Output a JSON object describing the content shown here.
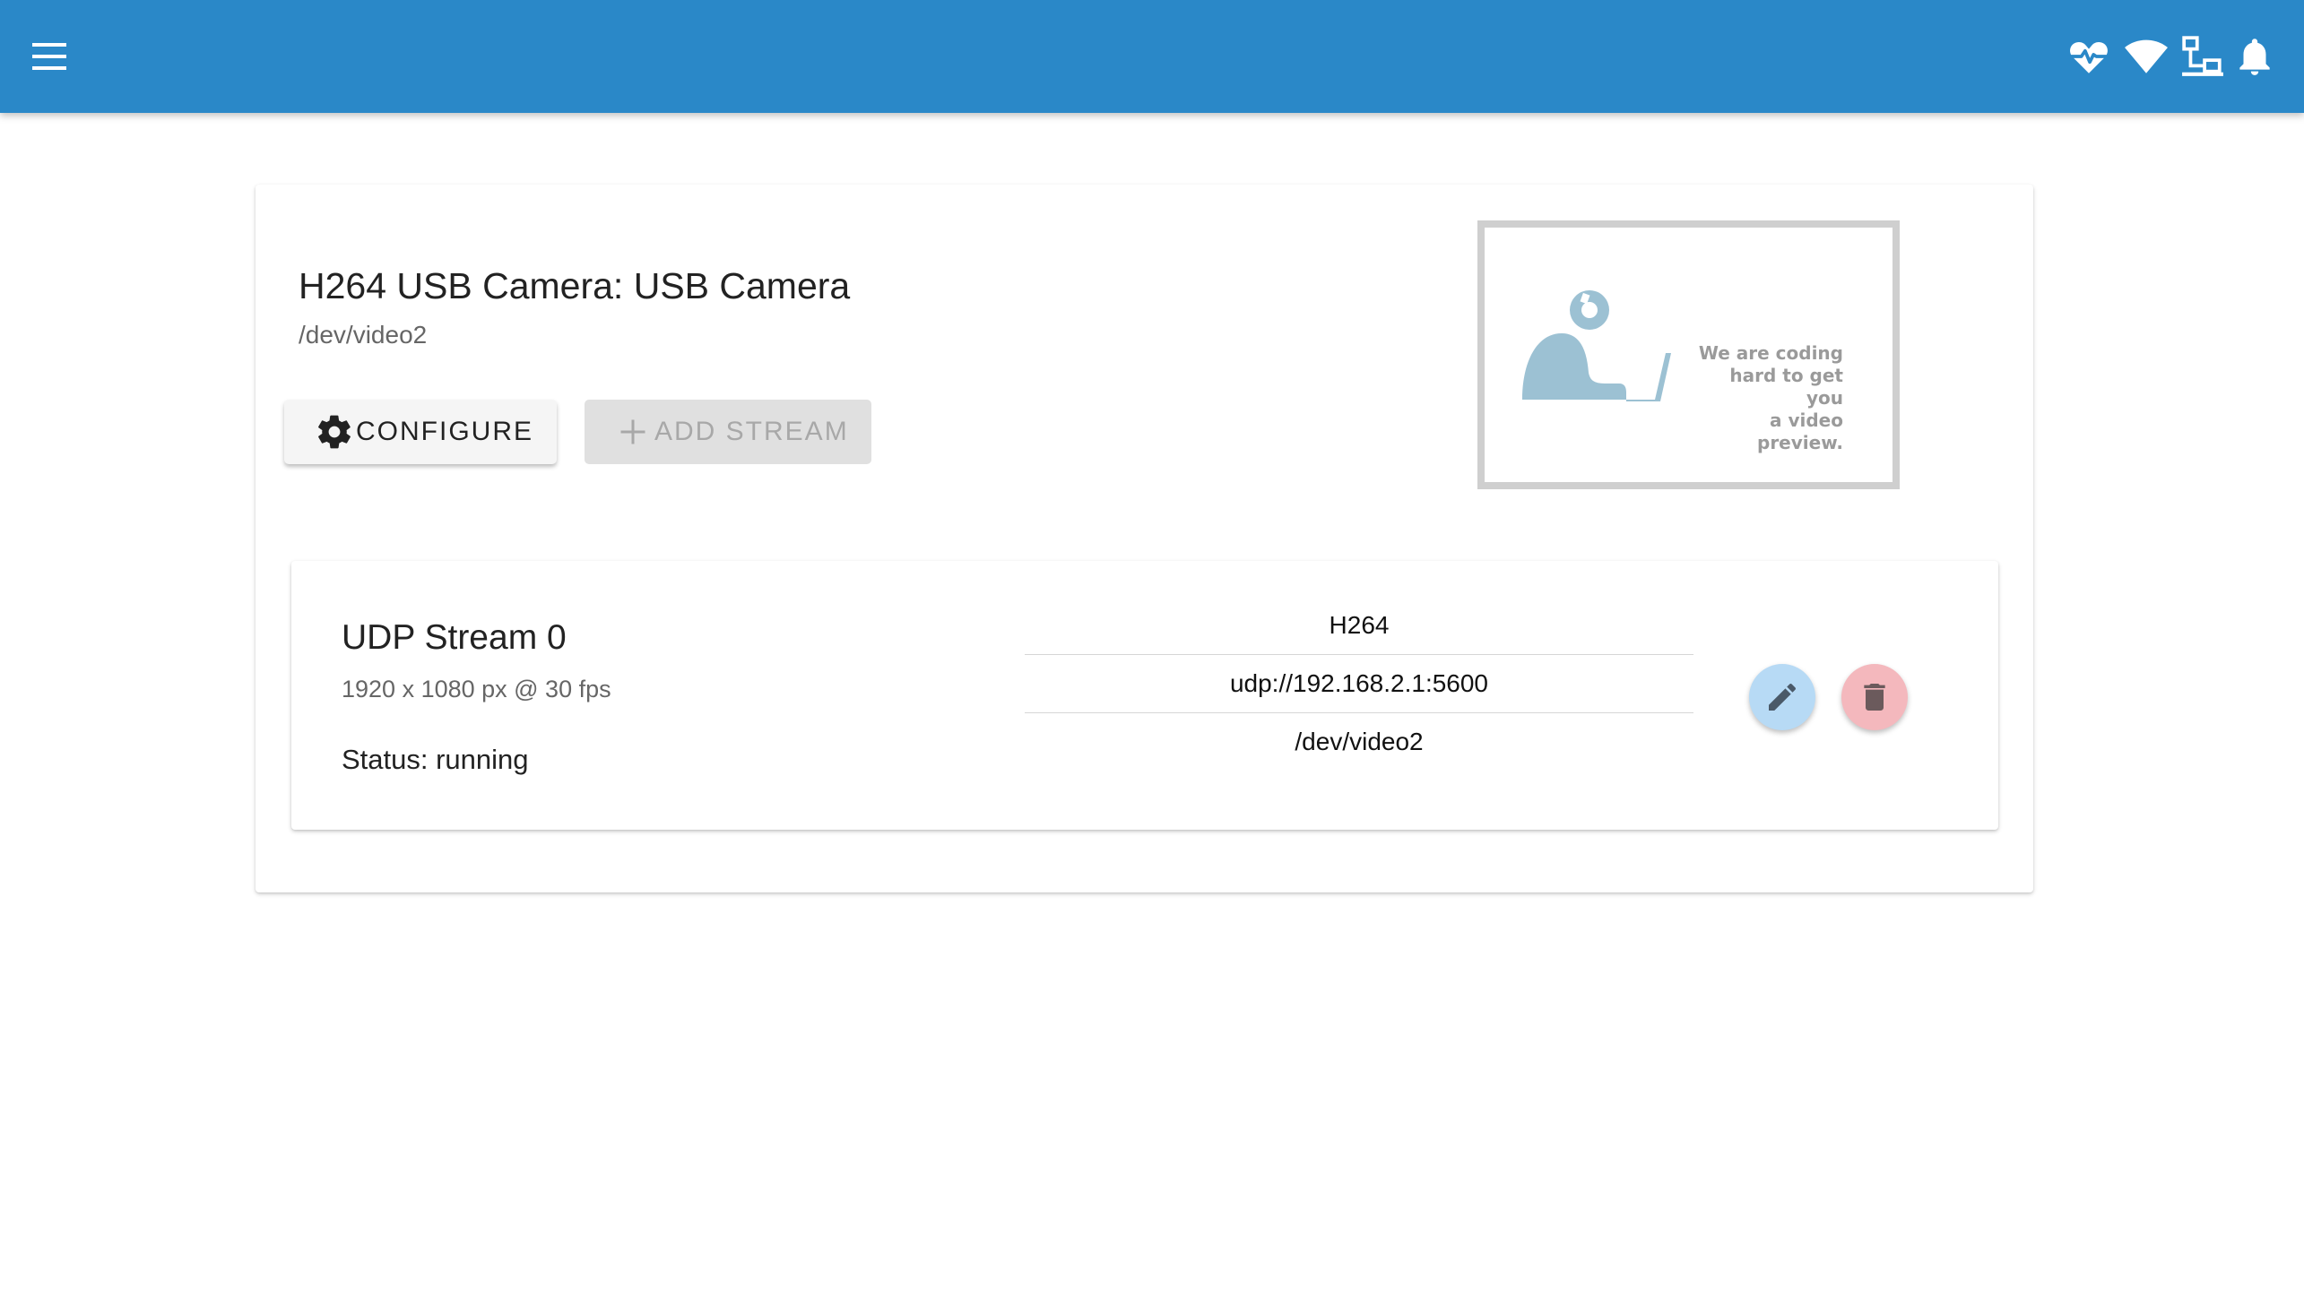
{
  "header": {
    "menu_icon": "hamburger-menu-icon",
    "status_icons": [
      "heartbeat-icon",
      "wifi-icon",
      "network-icon",
      "notifications-bell-icon"
    ]
  },
  "camera": {
    "title": "H264 USB Camera: USB Camera",
    "device": "/dev/video2",
    "configure_label": "CONFIGURE",
    "add_stream_label": "ADD STREAM",
    "preview_text_line1": "We are coding",
    "preview_text_line2": "hard to get you",
    "preview_text_line3": "a video preview."
  },
  "stream": {
    "title": "UDP Stream 0",
    "resolution": "1920 x 1080 px @ 30 fps",
    "status": "Status: running",
    "encoding": "H264",
    "endpoint": "udp://192.168.2.1:5600",
    "source": "/dev/video2"
  },
  "colors": {
    "appbar": "#2a88c8",
    "edit_fab": "#b7daf5",
    "delete_fab": "#f4b8bd"
  }
}
